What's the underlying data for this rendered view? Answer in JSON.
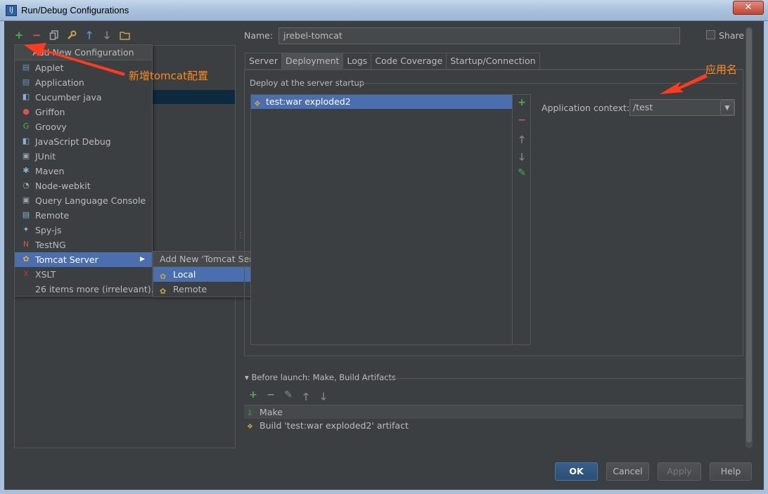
{
  "window": {
    "title": "Run/Debug Configurations",
    "close_label": "✕"
  },
  "left_toolbar": {
    "buttons": [
      "add-icon",
      "remove-icon",
      "copy-icon",
      "wrench-icon",
      "move-up-icon",
      "move-down-icon",
      "folder-icon"
    ]
  },
  "popup": {
    "header": "Add New Configuration",
    "items": [
      {
        "label": "Applet",
        "icon": "applet-icon",
        "glyph": "▤",
        "color": "#6a8ec4"
      },
      {
        "label": "Application",
        "icon": "application-icon",
        "glyph": "▤",
        "color": "#6a8ec4"
      },
      {
        "label": "Cucumber java",
        "icon": "cucumber-icon",
        "glyph": "◧",
        "color": "#7fb2de"
      },
      {
        "label": "Griffon",
        "icon": "griffon-icon",
        "glyph": "●",
        "color": "#d9534f"
      },
      {
        "label": "Groovy",
        "icon": "groovy-icon",
        "glyph": "G",
        "color": "#4caf50"
      },
      {
        "label": "JavaScript Debug",
        "icon": "javascript-debug-icon",
        "glyph": "◧",
        "color": "#7fb2de"
      },
      {
        "label": "JUnit",
        "icon": "junit-icon",
        "glyph": "▣",
        "color": "#9aa4ad"
      },
      {
        "label": "Maven",
        "icon": "maven-icon",
        "glyph": "✱",
        "color": "#7fb2de"
      },
      {
        "label": "Node-webkit",
        "icon": "node-webkit-icon",
        "glyph": "◔",
        "color": "#9aa4ad"
      },
      {
        "label": "Query Language Console",
        "icon": "query-console-icon",
        "glyph": "▣",
        "color": "#9aa4ad"
      },
      {
        "label": "Remote",
        "icon": "remote-icon",
        "glyph": "▤",
        "color": "#7fb2de"
      },
      {
        "label": "Spy-js",
        "icon": "spy-js-icon",
        "glyph": "✦",
        "color": "#7fb2de"
      },
      {
        "label": "TestNG",
        "icon": "testng-icon",
        "glyph": "N",
        "color": "#d9534f"
      },
      {
        "label": "Tomcat Server",
        "icon": "tomcat-icon",
        "glyph": "✿",
        "color": "#e0b040"
      },
      {
        "label": "XSLT",
        "icon": "xslt-icon",
        "glyph": "X",
        "color": "#c0392b"
      },
      {
        "label": "26 items more (irrelevant)...",
        "icon": "",
        "glyph": "",
        "color": "#bbbbbb"
      }
    ],
    "selected_index": 13
  },
  "submenu": {
    "header": "Add New 'Tomcat Server' Configuration",
    "items": [
      {
        "label": "Local",
        "selected": true
      },
      {
        "label": "Remote",
        "selected": false
      }
    ]
  },
  "form": {
    "name_label": "Name:",
    "name_value": "jrebel-tomcat",
    "share_label": "Share",
    "share_checked": false
  },
  "tabs": [
    {
      "label": "Server",
      "active": false
    },
    {
      "label": "Deployment",
      "active": true
    },
    {
      "label": "Logs",
      "active": false
    },
    {
      "label": "Code Coverage",
      "active": false
    },
    {
      "label": "Startup/Connection",
      "active": false
    }
  ],
  "deployment": {
    "group_title": "Deploy at the server startup",
    "artifacts": [
      "test:war exploded2"
    ],
    "context_label": "Application context:",
    "context_value": "/test"
  },
  "before_launch": {
    "title": "Before launch: Make, Build Artifacts",
    "items": [
      "Make",
      "Build 'test:war exploded2' artifact"
    ]
  },
  "buttons": {
    "ok": "OK",
    "cancel": "Cancel",
    "apply": "Apply",
    "help": "Help"
  },
  "annotations": {
    "add_tomcat": "新增tomcat配置",
    "app_name": "应用名",
    "color": "#ff3b1f"
  }
}
